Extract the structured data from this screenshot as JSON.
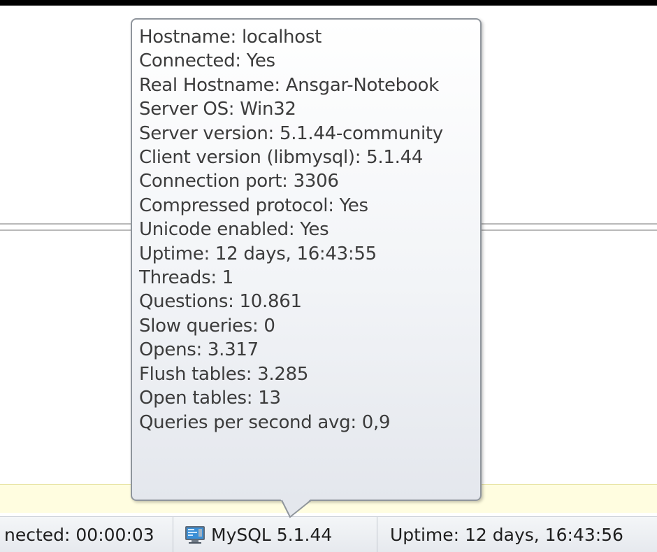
{
  "tooltip": {
    "lines": [
      "Hostname: localhost",
      "Connected: Yes",
      "Real Hostname: Ansgar-Notebook",
      "Server OS: Win32",
      "Server version: 5.1.44-community",
      "Client version (libmysql): 5.1.44",
      "Connection port: 3306",
      "Compressed protocol: Yes",
      "Unicode enabled: Yes",
      "Uptime: 12 days, 16:43:55",
      "Threads: 1",
      "Questions: 10.861",
      "Slow queries: 0",
      "Opens: 3.317",
      "Flush tables: 3.285",
      "Open tables: 13",
      "Queries per second avg: 0,9"
    ]
  },
  "statusbar": {
    "connected_text": "nected: 00:00:03",
    "server_icon": "server-icon",
    "server_text": "MySQL 5.1.44",
    "uptime_text": "Uptime: 12 days, 16:43:56"
  },
  "colors": {
    "tooltip_border": "#8f959c",
    "tooltip_text": "#3c3c3c",
    "yellow_strip": "#fffde0",
    "statusbar_bg": "#e6e9ee"
  }
}
